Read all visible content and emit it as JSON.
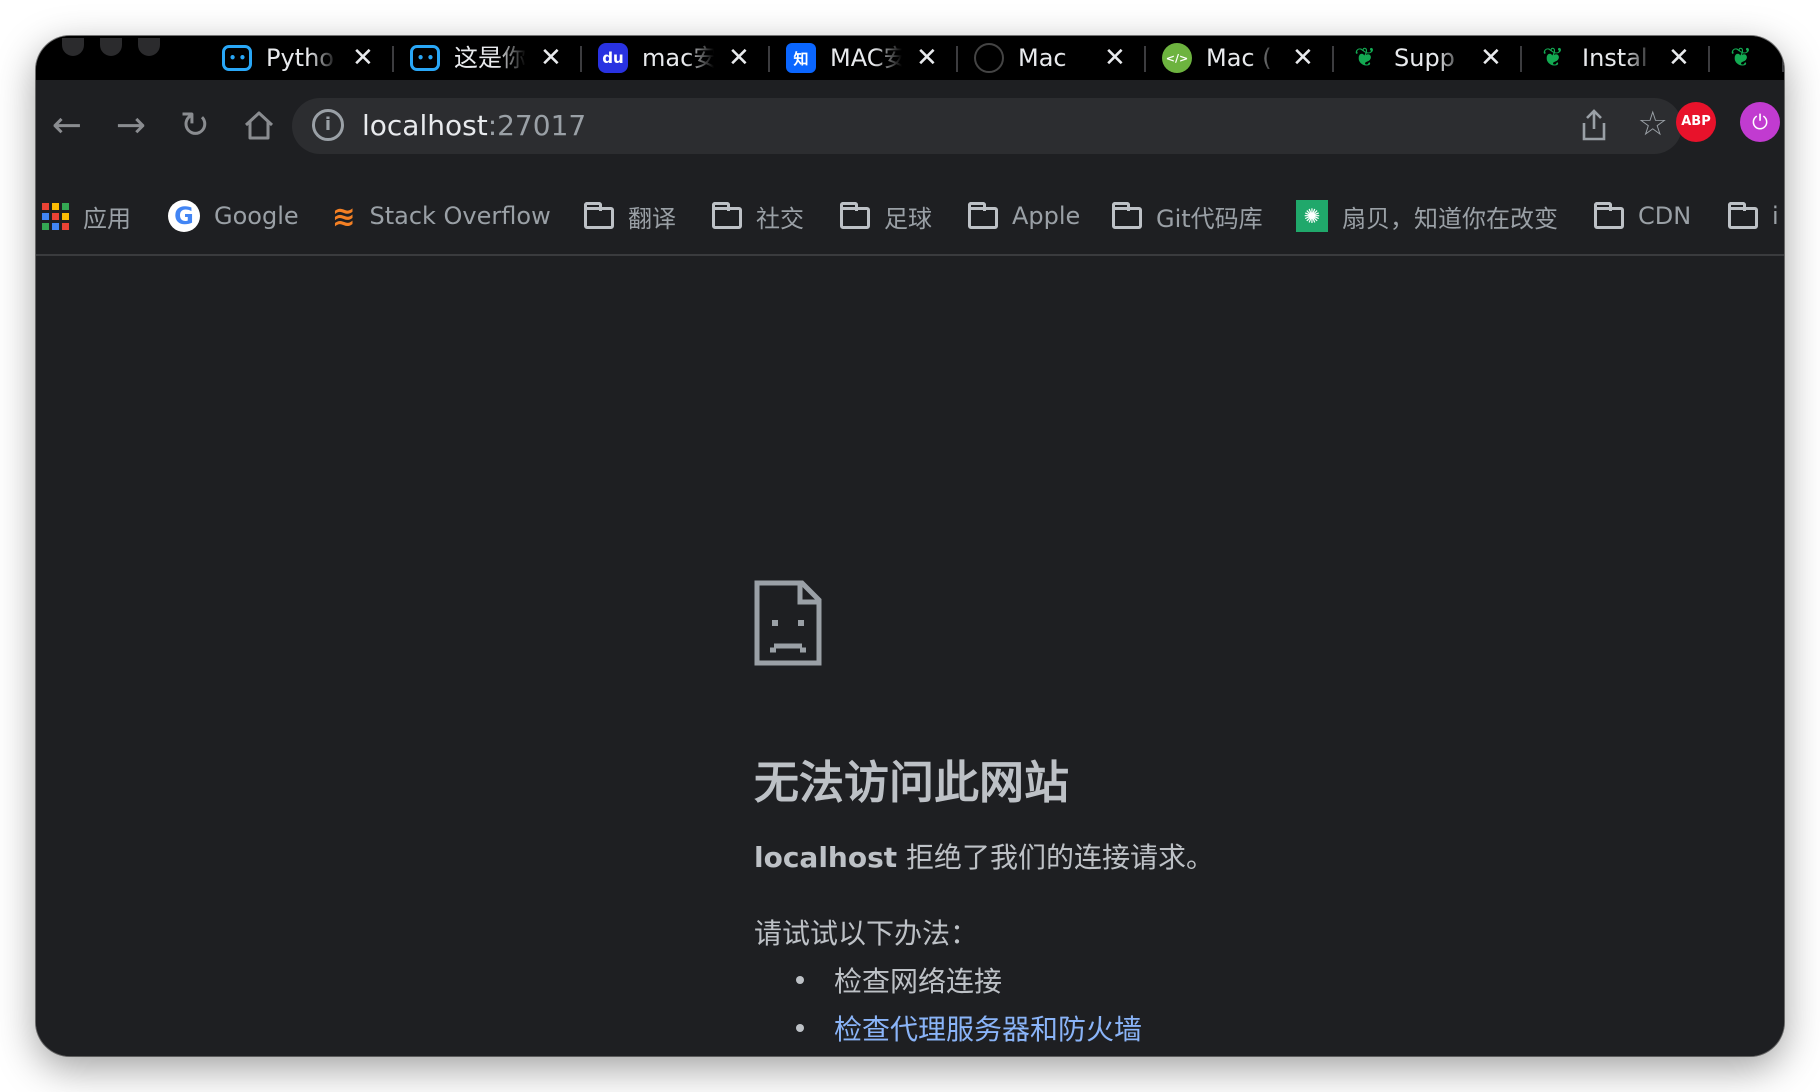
{
  "tabs": [
    {
      "title": "Pytho",
      "icon": "robot-icon"
    },
    {
      "title": "这是你",
      "icon": "robot-icon"
    },
    {
      "title": "mac安",
      "icon": "baidu-icon"
    },
    {
      "title": "MAC安",
      "icon": "zhihu-icon"
    },
    {
      "title": "Mac",
      "icon": "github-icon"
    },
    {
      "title": "Mac (",
      "icon": "code-icon"
    },
    {
      "title": "Supp",
      "icon": "mongodb-leaf-icon"
    },
    {
      "title": "Instal",
      "icon": "mongodb-leaf-icon"
    }
  ],
  "tab_close_glyph": "✕",
  "address_bar": {
    "host": "localhost",
    "port": ":27017"
  },
  "extensions": {
    "abp_label": "ABP"
  },
  "bookmarks": [
    {
      "label": "应用",
      "icon": "apps-grid-icon"
    },
    {
      "label": "Google",
      "icon": "google-icon"
    },
    {
      "label": "Stack Overflow",
      "icon": "stackoverflow-icon"
    },
    {
      "label": "翻译",
      "icon": "folder-icon"
    },
    {
      "label": "社交",
      "icon": "folder-icon"
    },
    {
      "label": "足球",
      "icon": "folder-icon"
    },
    {
      "label": "Apple",
      "icon": "folder-icon"
    },
    {
      "label": "Git代码库",
      "icon": "folder-icon"
    },
    {
      "label": "扇贝，知道你在改变",
      "icon": "shanbay-icon"
    },
    {
      "label": "CDN",
      "icon": "folder-icon"
    },
    {
      "label": "i",
      "icon": "folder-icon"
    }
  ],
  "error_page": {
    "title": "无法访问此网站",
    "host": "localhost",
    "message": " 拒绝了我们的连接请求。",
    "try_heading": "请试试以下办法：",
    "suggestions": [
      {
        "text": "检查网络连接",
        "link": false
      },
      {
        "text": "检查代理服务器和防火墙",
        "link": true
      }
    ]
  },
  "colors": {
    "window_bg": "#1e1f22",
    "tab_strip": "#000000",
    "link": "#8ab4f8",
    "text": "#bdc1c6"
  }
}
